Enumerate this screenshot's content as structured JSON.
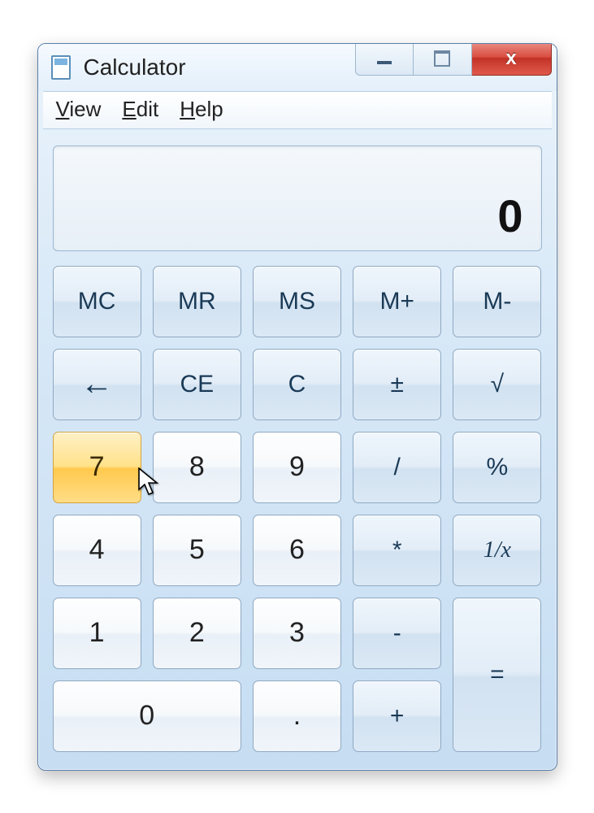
{
  "window": {
    "title": "Calculator",
    "controls": {
      "minimize": "–",
      "maximize": "❐",
      "close": "x"
    }
  },
  "menu": {
    "view": "View",
    "view_ul": "V",
    "view_rest": "iew",
    "edit": "Edit",
    "edit_ul": "E",
    "edit_rest": "dit",
    "help": "Help",
    "help_ul": "H",
    "help_rest": "elp"
  },
  "display": {
    "value": "0"
  },
  "keys": {
    "mc": "MC",
    "mr": "MR",
    "ms": "MS",
    "mplus": "M+",
    "mminus": "M-",
    "back": "←",
    "ce": "CE",
    "c": "C",
    "negate": "±",
    "sqrt": "√",
    "n7": "7",
    "n8": "8",
    "n9": "9",
    "div": "/",
    "pct": "%",
    "n4": "4",
    "n5": "5",
    "n6": "6",
    "mul": "*",
    "recip": "1/x",
    "n1": "1",
    "n2": "2",
    "n3": "3",
    "sub": "-",
    "eq": "=",
    "n0": "0",
    "dot": ".",
    "add": "+"
  },
  "hovered_key": "n7"
}
